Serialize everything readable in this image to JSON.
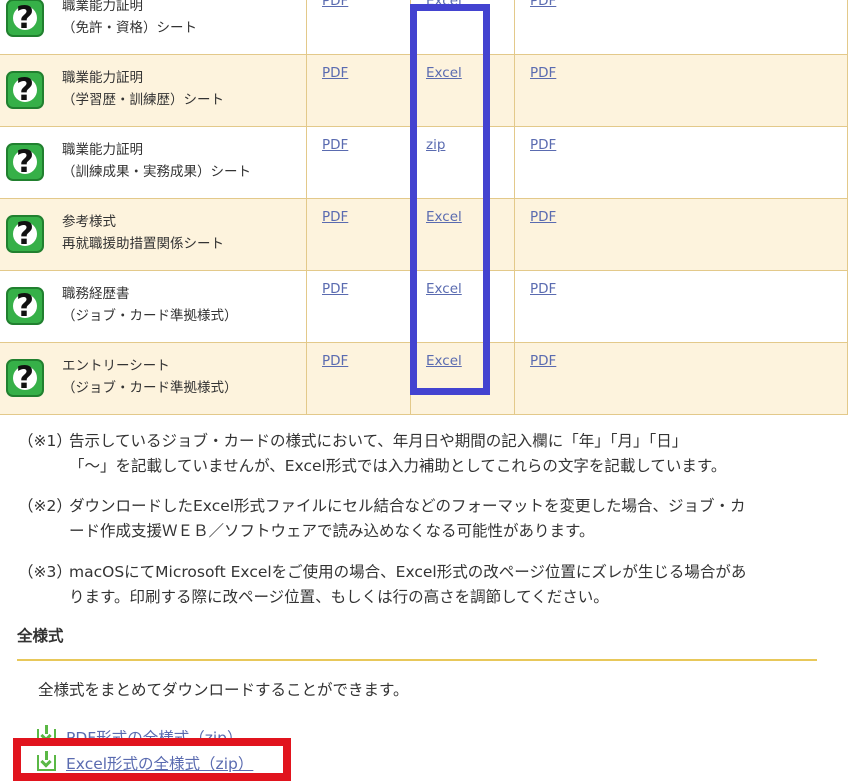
{
  "rows": [
    {
      "line1": "職業能力証明",
      "line2": "（免許・資格）シート",
      "pdf1": "PDF",
      "file": "Excel",
      "pdf2": "PDF"
    },
    {
      "line1": "職業能力証明",
      "line2": "（学習歴・訓練歴）シート",
      "pdf1": "PDF",
      "file": "Excel",
      "pdf2": "PDF"
    },
    {
      "line1": "職業能力証明",
      "line2": "（訓練成果・実務成果）シート",
      "pdf1": "PDF",
      "file": "zip",
      "pdf2": "PDF"
    },
    {
      "line1": "参考様式",
      "line2": "再就職援助措置関係シート",
      "pdf1": "PDF",
      "file": "Excel",
      "pdf2": "PDF"
    },
    {
      "line1": "職務経歴書",
      "line2": "（ジョブ・カード準拠様式）",
      "pdf1": "PDF",
      "file": "Excel",
      "pdf2": "PDF"
    },
    {
      "line1": "エントリーシート",
      "line2": "（ジョブ・カード準拠様式）",
      "pdf1": "PDF",
      "file": "Excel",
      "pdf2": "PDF"
    }
  ],
  "icon": {
    "help_glyph": "?",
    "name": "question-icon"
  },
  "notes": [
    {
      "mark": "（※1）",
      "line1": "告示しているジョブ・カードの様式において、年月日や期間の記入欄に「年」「月」「日」",
      "line2": "「～」を記載していませんが、Excel形式では入力補助としてこれらの文字を記載しています。"
    },
    {
      "mark": "（※2）",
      "line1": "ダウンロードしたExcel形式ファイルにセル結合などのフォーマットを変更した場合、ジョブ・カ",
      "line2": "ード作成支援ＷＥＢ／ソフトウェアで読み込めなくなる可能性があります。"
    },
    {
      "mark": "（※3）",
      "line1": "macOSにてMicrosoft Excelをご使用の場合、Excel形式の改ページ位置にズレが生じる場合があ",
      "line2": "ります。印刷する際に改ページ位置、もしくは行の高さを調節してください。"
    }
  ],
  "section": {
    "title": "全様式",
    "description": "全様式をまとめてダウンロードすることができます。",
    "links": [
      {
        "label": "PDF形式の全様式（zip）"
      },
      {
        "label": "Excel形式の全様式（zip）"
      }
    ]
  },
  "colors": {
    "row_alt": "#fdf3dd",
    "border": "#e3c98a",
    "link": "#5a6bb0",
    "icon_green": "#36b048",
    "highlight_blue": "#4343d0",
    "highlight_red": "#e1141e",
    "section_rule": "#e8c85a"
  }
}
